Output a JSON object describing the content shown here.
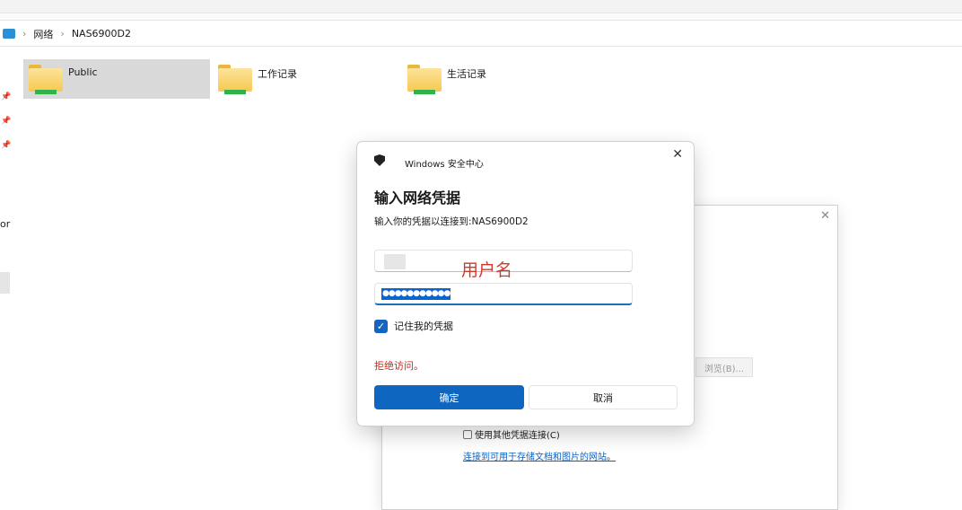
{
  "breadcrumb": {
    "items": [
      "网络",
      "NAS6900D2"
    ]
  },
  "sidebar": {
    "partial_label": "or"
  },
  "folders": [
    {
      "name": "Public",
      "selected": true
    },
    {
      "name": "工作记录",
      "selected": false
    },
    {
      "name": "生活记录",
      "selected": false
    }
  ],
  "background_dialog": {
    "browse_label": "浏览(B)...",
    "other_credentials_label": "使用其他凭据连接(C)",
    "link_text": "连接到可用于存储文档和图片的网站",
    "link_suffix": "。"
  },
  "dialog": {
    "app_title": "Windows 安全中心",
    "heading": "输入网络凭据",
    "subtitle": "输入你的凭据以连接到:NAS6900D2",
    "annotation": "用户名",
    "password_mask": "●●●●●●●●●●●",
    "remember_label": "记住我的凭据",
    "remember_checked": true,
    "error": "拒绝访问。",
    "ok_label": "确定",
    "cancel_label": "取消",
    "accent": "#0f66c1"
  }
}
